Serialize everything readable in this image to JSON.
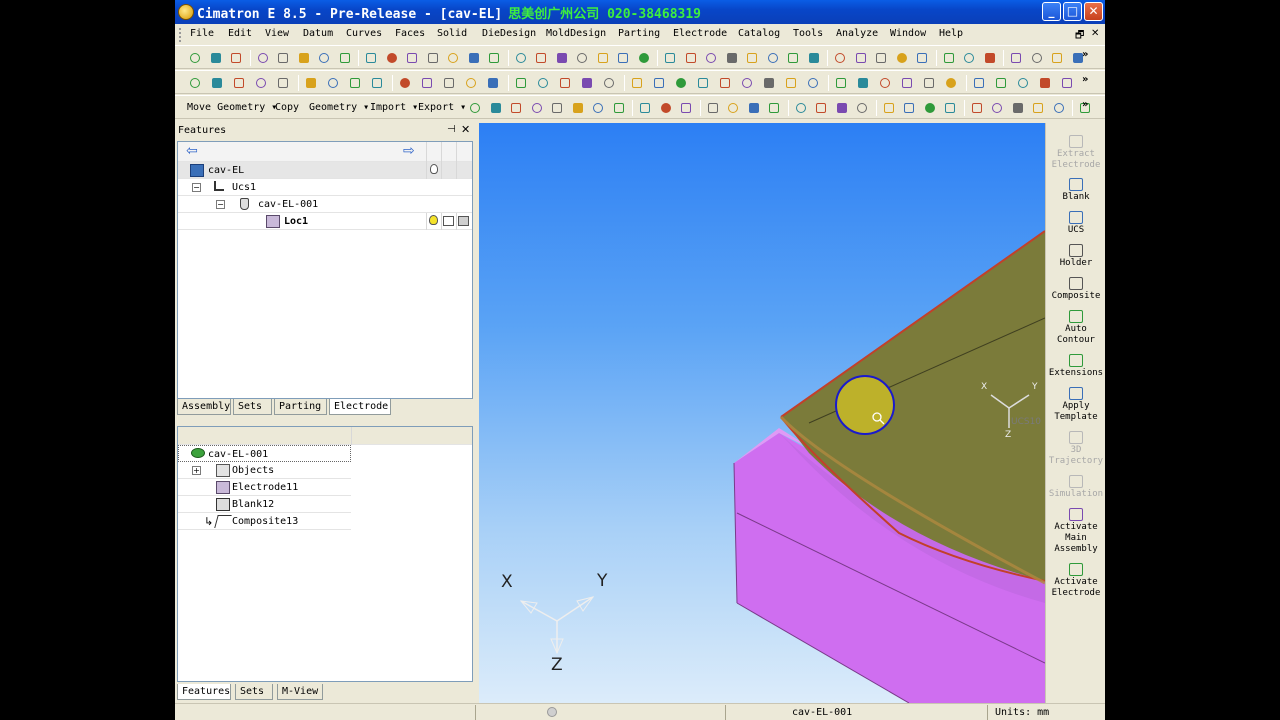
{
  "window": {
    "title": "Cimatron E 8.5 - Pre-Release - [cav-EL]",
    "title_cn": "思美创广州公司 020-38468319",
    "buttons": {
      "minimize": "_",
      "maximize": "□",
      "close": "✕"
    }
  },
  "menu": {
    "items": [
      "File",
      "Edit",
      "View",
      "Datum",
      "Curves",
      "Faces",
      "Solid",
      "DieDesign",
      "MoldDesign",
      "Parting",
      "Electrode",
      "Catalog",
      "Tools",
      "Analyze",
      "Window",
      "Help"
    ],
    "mdi_restore": "🗗",
    "mdi_close": "✕"
  },
  "toolbar3": {
    "move_geometry": "Move Geometry ▾",
    "copy": "Copy",
    "geometry": "Geometry ▾",
    "import": "Import ▾",
    "export": "Export ▾"
  },
  "features_panel": {
    "title": "Features",
    "pin": "⊣",
    "close": "✕",
    "nav_back": "⇦",
    "nav_forward": "⇨",
    "tree": [
      {
        "label": "cav-EL"
      },
      {
        "label": "Ucs1"
      },
      {
        "label": "cav-EL-001"
      },
      {
        "label": "Loc1"
      }
    ],
    "tabs": [
      "Assembly",
      "Sets",
      "Parting",
      "Electrode"
    ],
    "electrode_tree": [
      {
        "label": "cav-EL-001"
      },
      {
        "label": "Objects"
      },
      {
        "label": "Electrode11"
      },
      {
        "label": "Blank12"
      },
      {
        "label": "Composite13"
      }
    ],
    "bottom_tabs": [
      "Features",
      "Sets",
      "M-View"
    ]
  },
  "viewport": {
    "triad_main": {
      "x": "X",
      "y": "Y",
      "z": "Z"
    },
    "triad_ucs": {
      "x": "X",
      "y": "Y",
      "z": "Z",
      "label": "UCS10"
    },
    "colors": {
      "sky_top": "#2c7ff4",
      "sky_bottom": "#dcecfa",
      "electrode_face": "#7b7b3a",
      "block": "#d783f5",
      "highlight": "#bdb12a"
    }
  },
  "right_bar": {
    "items": [
      {
        "label": "Extract Electrode",
        "enabled": false,
        "icon": "extract-icon"
      },
      {
        "label": "Blank",
        "enabled": true,
        "icon": "blank-icon"
      },
      {
        "label": "UCS",
        "enabled": true,
        "icon": "ucs-icon"
      },
      {
        "label": "Holder",
        "enabled": true,
        "icon": "holder-icon"
      },
      {
        "label": "Composite",
        "enabled": true,
        "icon": "composite-icon"
      },
      {
        "label": "Auto Contour",
        "enabled": true,
        "icon": "auto-contour-icon"
      },
      {
        "label": "Extensions",
        "enabled": true,
        "icon": "extensions-icon"
      },
      {
        "label": "Apply Template",
        "enabled": true,
        "icon": "apply-template-icon"
      },
      {
        "label": "3D Trajectory",
        "enabled": false,
        "icon": "trajectory-icon"
      },
      {
        "label": "Simulation",
        "enabled": false,
        "icon": "simulation-icon"
      },
      {
        "label": "Activate Main Assembly",
        "enabled": true,
        "icon": "activate-main-icon"
      },
      {
        "label": "Activate Electrode",
        "enabled": true,
        "icon": "activate-electrode-icon"
      }
    ]
  },
  "status_bar": {
    "document": "cav-EL-001",
    "units": "Units: mm"
  }
}
